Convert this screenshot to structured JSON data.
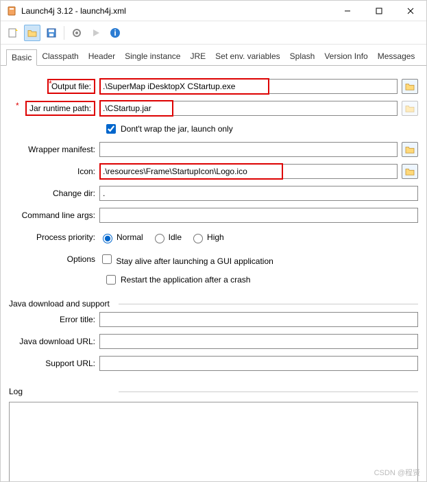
{
  "title": "Launch4j 3.12 - launch4j.xml",
  "tabs": [
    "Basic",
    "Classpath",
    "Header",
    "Single instance",
    "JRE",
    "Set env. variables",
    "Splash",
    "Version Info",
    "Messages"
  ],
  "active_tab": "Basic",
  "labels": {
    "output_file": "Output file:",
    "jar": "Jar",
    "runtime_path": "runtime path:",
    "dont_wrap": "Dont't wrap the jar, launch only",
    "wrapper_manifest": "Wrapper manifest:",
    "icon": "Icon:",
    "change_dir": "Change dir:",
    "cmd_args": "Command line args:",
    "priority": "Process priority:",
    "normal": "Normal",
    "idle": "Idle",
    "high": "High",
    "options": "Options",
    "stay_alive": "Stay alive after launching a GUI application",
    "restart": "Restart the application after a crash",
    "java_dl": "Java download and support",
    "error_title": "Error title:",
    "java_dl_url": "Java download URL:",
    "support_url": "Support URL:",
    "log": "Log"
  },
  "values": {
    "output_file": ".\\SuperMap iDesktopX CStartup.exe",
    "jar_runtime": ".\\CStartup.jar",
    "dont_wrap": true,
    "wrapper_manifest": "",
    "icon": ".\\resources\\Frame\\StartupIcon\\Logo.ico",
    "change_dir": ".",
    "cmd_args": "",
    "priority": "Normal",
    "stay_alive": false,
    "restart": false,
    "error_title": "",
    "java_dl_url": "",
    "support_url": ""
  },
  "watermark": "CSDN @程贤"
}
